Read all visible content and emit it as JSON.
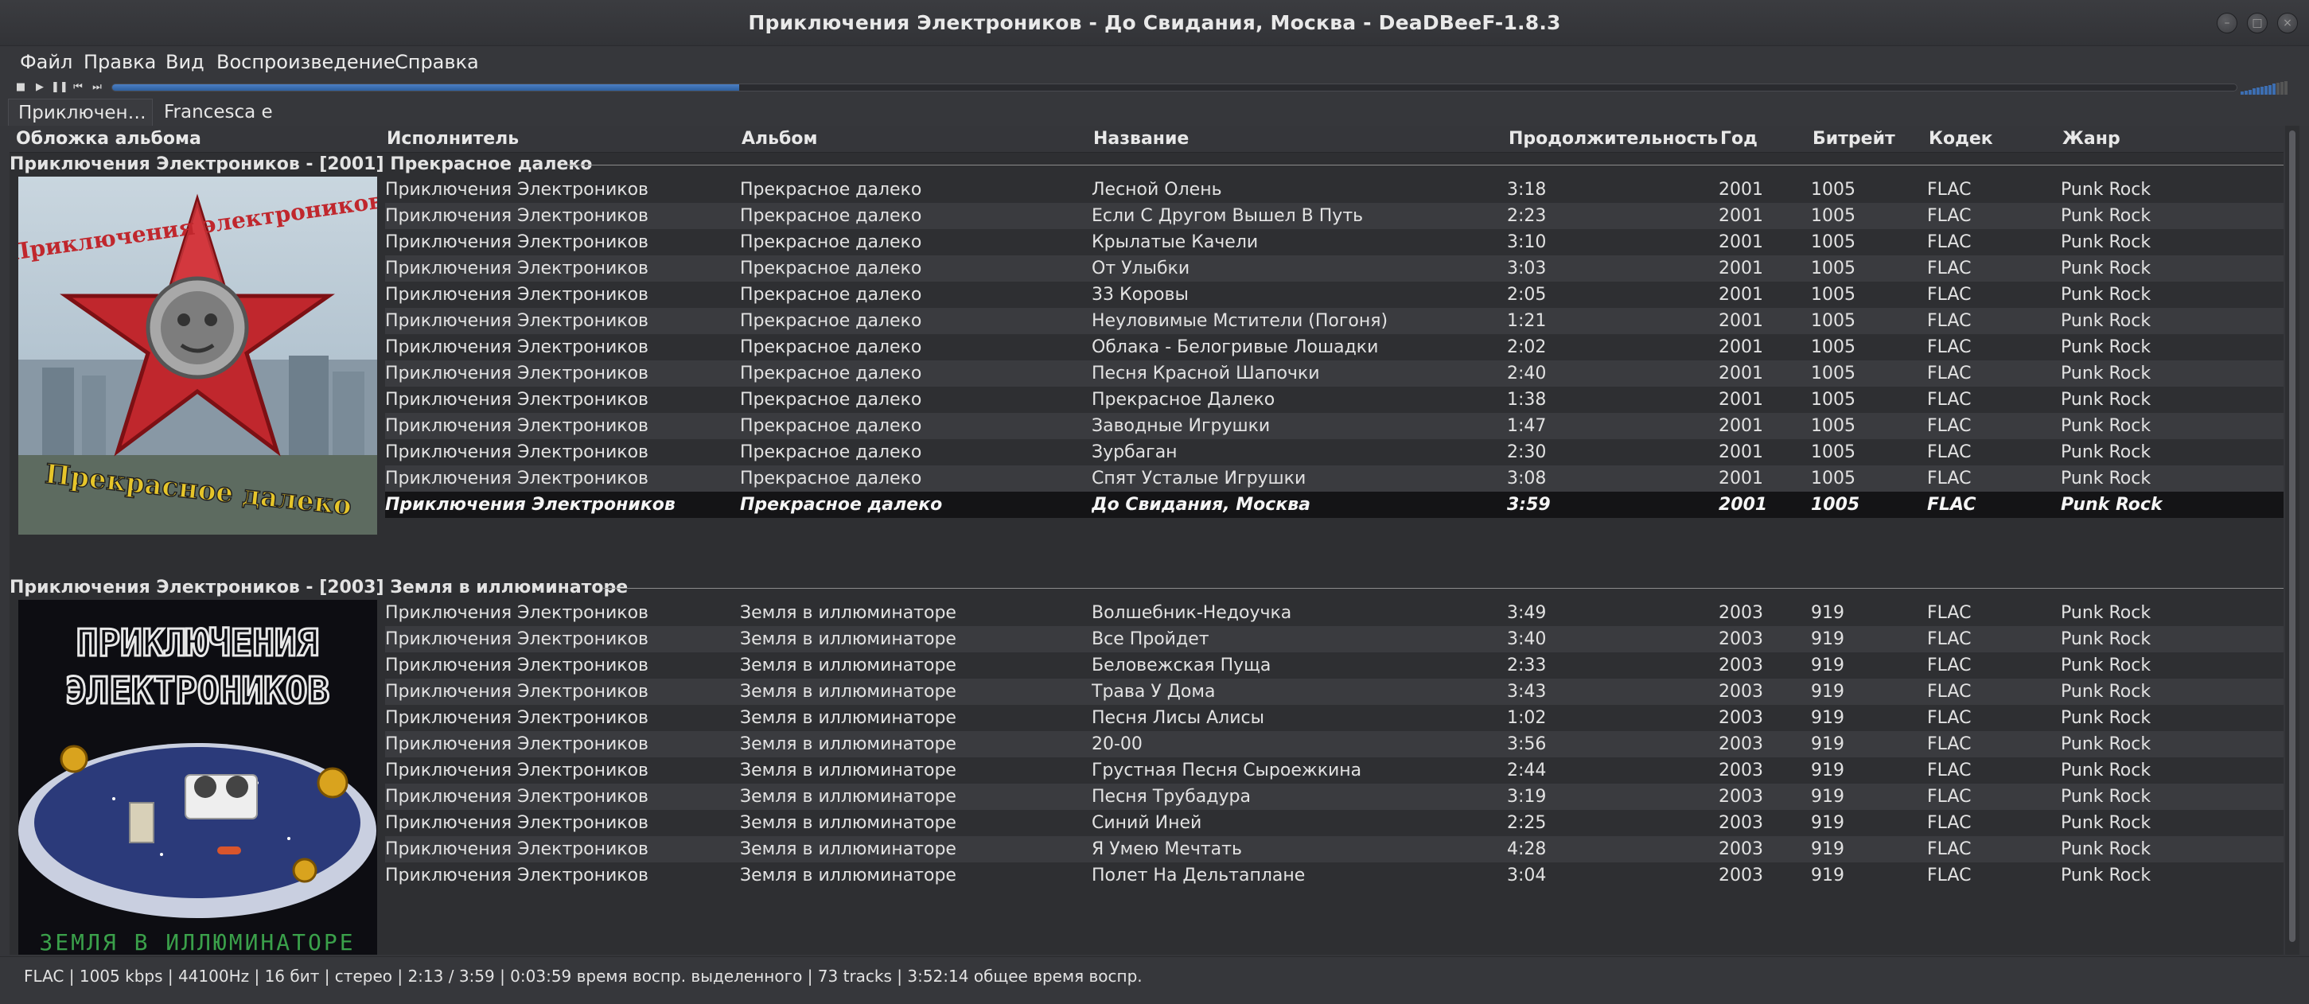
{
  "window": {
    "title": "Приключения Электроников - До Свидания, Москва - DeaDBeeF-1.8.3"
  },
  "menu": [
    "Файл",
    "Правка",
    "Вид",
    "Воспроизведение",
    "Справка"
  ],
  "toolbar": {
    "buttons": [
      "stop-icon",
      "play-icon",
      "pause-icon",
      "previous-icon",
      "next-icon"
    ],
    "seek_progress": 0.295,
    "volume_level": 0.7
  },
  "tabs": [
    "Приключен…",
    "Francesca e …"
  ],
  "columns": [
    "Обложка альбома",
    "Исполнитель",
    "Альбом",
    "Название",
    "Продолжительность",
    "Год",
    "Битрейт",
    "Кодек",
    "Жанр"
  ],
  "groups": [
    {
      "title": "Приключения Электроников - [2001] Прекрасное далеко",
      "art_text": "Прекрасное далеко",
      "tracks": [
        [
          "Приключения Электроников",
          "Прекрасное далеко",
          "Лесной Олень",
          "3:18",
          "2001",
          "1005",
          "FLAC",
          "Punk Rock"
        ],
        [
          "Приключения Электроников",
          "Прекрасное далеко",
          "Если С Другом Вышел В Путь",
          "2:23",
          "2001",
          "1005",
          "FLAC",
          "Punk Rock"
        ],
        [
          "Приключения Электроников",
          "Прекрасное далеко",
          "Крылатые Качели",
          "3:10",
          "2001",
          "1005",
          "FLAC",
          "Punk Rock"
        ],
        [
          "Приключения Электроников",
          "Прекрасное далеко",
          "От Улыбки",
          "3:03",
          "2001",
          "1005",
          "FLAC",
          "Punk Rock"
        ],
        [
          "Приключения Электроников",
          "Прекрасное далеко",
          "33 Коровы",
          "2:05",
          "2001",
          "1005",
          "FLAC",
          "Punk Rock"
        ],
        [
          "Приключения Электроников",
          "Прекрасное далеко",
          "Неуловимые Мстители (Погоня)",
          "1:21",
          "2001",
          "1005",
          "FLAC",
          "Punk Rock"
        ],
        [
          "Приключения Электроников",
          "Прекрасное далеко",
          "Облака - Белогривые Лошадки",
          "2:02",
          "2001",
          "1005",
          "FLAC",
          "Punk Rock"
        ],
        [
          "Приключения Электроников",
          "Прекрасное далеко",
          "Песня Красной Шапочки",
          "2:40",
          "2001",
          "1005",
          "FLAC",
          "Punk Rock"
        ],
        [
          "Приключения Электроников",
          "Прекрасное далеко",
          "Прекрасное Далеко",
          "1:38",
          "2001",
          "1005",
          "FLAC",
          "Punk Rock"
        ],
        [
          "Приключения Электроников",
          "Прекрасное далеко",
          "Заводные Игрушки",
          "1:47",
          "2001",
          "1005",
          "FLAC",
          "Punk Rock"
        ],
        [
          "Приключения Электроников",
          "Прекрасное далеко",
          "Зурбаган",
          "2:30",
          "2001",
          "1005",
          "FLAC",
          "Punk Rock"
        ],
        [
          "Приключения Электроников",
          "Прекрасное далеко",
          "Спят Усталые Игрушки",
          "3:08",
          "2001",
          "1005",
          "FLAC",
          "Punk Rock"
        ],
        [
          "Приключения Электроников",
          "Прекрасное далеко",
          "До Свидания, Москва",
          "3:59",
          "2001",
          "1005",
          "FLAC",
          "Punk Rock"
        ]
      ],
      "playing_index": 12
    },
    {
      "title": "Приключения Электроников - [2003] Земля в иллюминаторе",
      "art_text": "ЗЕМЛЯ В ИЛЛЮМИНАТОРЕ",
      "tracks": [
        [
          "Приключения Электроников",
          "Земля в иллюминаторе",
          "Волшебник-Недоучка",
          "3:49",
          "2003",
          "919",
          "FLAC",
          "Punk Rock"
        ],
        [
          "Приключения Электроников",
          "Земля в иллюминаторе",
          "Все Пройдет",
          "3:40",
          "2003",
          "919",
          "FLAC",
          "Punk Rock"
        ],
        [
          "Приключения Электроников",
          "Земля в иллюминаторе",
          "Беловежская Пуща",
          "2:33",
          "2003",
          "919",
          "FLAC",
          "Punk Rock"
        ],
        [
          "Приключения Электроников",
          "Земля в иллюминаторе",
          "Трава У Дома",
          "3:43",
          "2003",
          "919",
          "FLAC",
          "Punk Rock"
        ],
        [
          "Приключения Электроников",
          "Земля в иллюминаторе",
          "Песня Лисы Алисы",
          "1:02",
          "2003",
          "919",
          "FLAC",
          "Punk Rock"
        ],
        [
          "Приключения Электроников",
          "Земля в иллюминаторе",
          "20-00",
          "3:56",
          "2003",
          "919",
          "FLAC",
          "Punk Rock"
        ],
        [
          "Приключения Электроников",
          "Земля в иллюминаторе",
          "Грустная Песня Сыроежкина",
          "2:44",
          "2003",
          "919",
          "FLAC",
          "Punk Rock"
        ],
        [
          "Приключения Электроников",
          "Земля в иллюминаторе",
          "Песня Трубадура",
          "3:19",
          "2003",
          "919",
          "FLAC",
          "Punk Rock"
        ],
        [
          "Приключения Электроников",
          "Земля в иллюминаторе",
          "Синий Иней",
          "2:25",
          "2003",
          "919",
          "FLAC",
          "Punk Rock"
        ],
        [
          "Приключения Электроников",
          "Земля в иллюминаторе",
          "Я Умею Мечтать",
          "4:28",
          "2003",
          "919",
          "FLAC",
          "Punk Rock"
        ],
        [
          "Приключения Электроников",
          "Земля в иллюминаторе",
          "Полет На Дельтаплане",
          "3:04",
          "2003",
          "919",
          "FLAC",
          "Punk Rock"
        ]
      ],
      "playing_index": -1
    }
  ],
  "status": "FLAC | 1005 kbps | 44100Hz | 16 бит | стерео | 2:13 / 3:59 | 0:03:59 время воспр. выделенного | 73 tracks | 3:52:14 общее время воспр."
}
